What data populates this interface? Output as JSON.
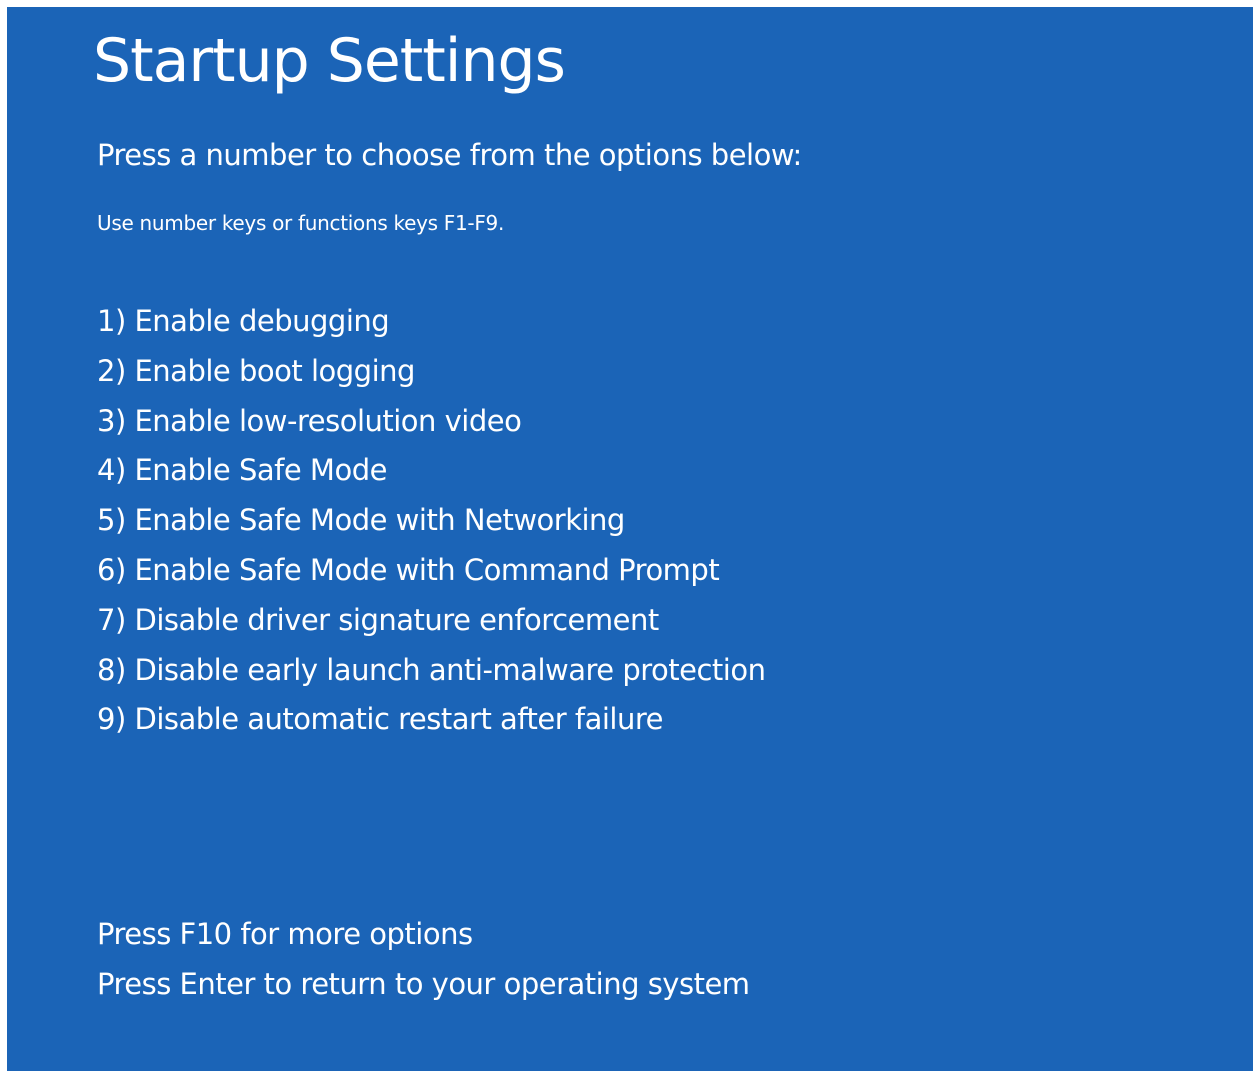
{
  "screen": {
    "background_color": "#1b64b7",
    "text_color": "#ffffff",
    "title": "Startup Settings",
    "instruction": "Press a number to choose from the options below:",
    "hint": "Use number keys or functions keys F1-F9."
  },
  "options": [
    {
      "label": "1) Enable debugging"
    },
    {
      "label": "2) Enable boot logging"
    },
    {
      "label": "3) Enable low-resolution video"
    },
    {
      "label": "4) Enable Safe Mode"
    },
    {
      "label": "5) Enable Safe Mode with Networking"
    },
    {
      "label": "6) Enable Safe Mode with Command Prompt"
    },
    {
      "label": "7) Disable driver signature enforcement"
    },
    {
      "label": "8) Disable early launch anti-malware protection"
    },
    {
      "label": "9) Disable automatic restart after failure"
    }
  ],
  "footer": {
    "more_options": "Press F10 for more options",
    "return_os": "Press Enter to return to your operating system"
  }
}
